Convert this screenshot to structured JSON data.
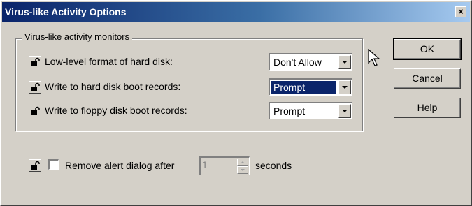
{
  "window": {
    "title": "Virus-like Activity Options",
    "close_label": "×"
  },
  "monitors": {
    "legend": "Virus-like activity monitors",
    "rows": [
      {
        "label": "Low-level format of hard disk:",
        "value": "Don't Allow",
        "focused": false
      },
      {
        "label": "Write to hard disk boot records:",
        "value": "Prompt",
        "focused": true
      },
      {
        "label": "Write to floppy disk boot records:",
        "value": "Prompt",
        "focused": false
      }
    ]
  },
  "buttons": {
    "ok": "OK",
    "cancel": "Cancel",
    "help": "Help"
  },
  "alert": {
    "label": "Remove alert dialog after",
    "checked": false,
    "seconds_value": "1",
    "suffix": "seconds"
  },
  "icons": {
    "lock": "padlock-icon",
    "cursor": "mouse-pointer-icon"
  },
  "colors": {
    "titlebar_start": "#0a246a",
    "titlebar_end": "#a6caf0",
    "dialog_bg": "#d4d0c8",
    "selection": "#0a246a"
  }
}
